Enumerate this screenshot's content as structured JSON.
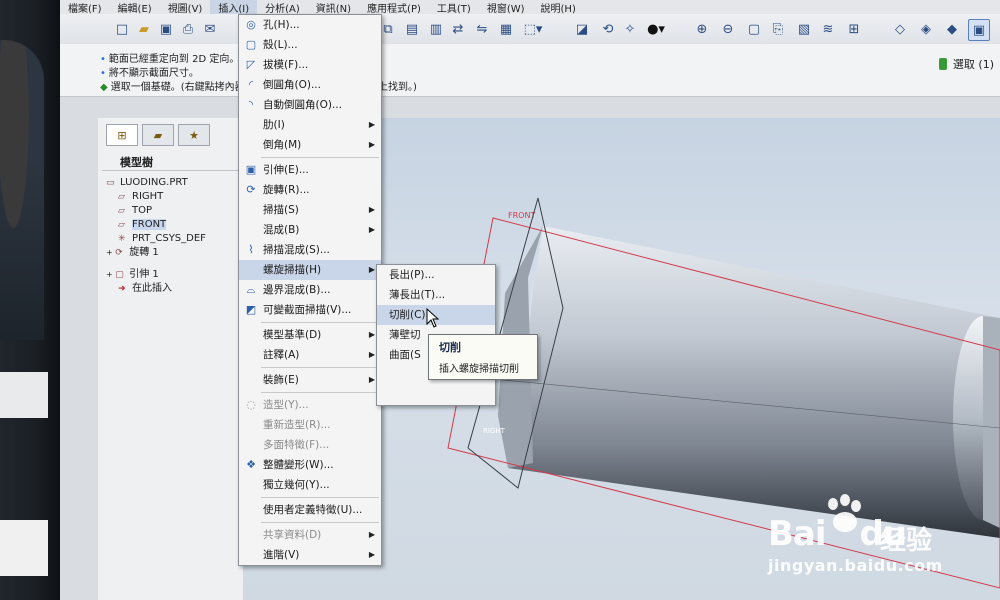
{
  "menubar": {
    "items": [
      "檔案(F)",
      "編輯(E)",
      "視圖(V)",
      "插入(I)",
      "分析(A)",
      "資訊(N)",
      "應用程式(P)",
      "工具(T)",
      "視窗(W)",
      "說明(H)"
    ]
  },
  "messages": [
    "範面已經重定向到 2D 定向。",
    "將不顯示截面尺寸。",
    "選取一個基礎。(右鍵點拷內器",
    "上找到。)"
  ],
  "select_label": "選取 (1)",
  "model_tree": {
    "title": "模型樹",
    "nodes": [
      {
        "label": "LUODING.PRT",
        "icon": "part-icon"
      },
      {
        "label": "RIGHT",
        "icon": "datum-plane-icon"
      },
      {
        "label": "TOP",
        "icon": "datum-plane-icon"
      },
      {
        "label": "FRONT",
        "icon": "datum-plane-icon",
        "selected": true
      },
      {
        "label": "PRT_CSYS_DEF",
        "icon": "csys-icon"
      },
      {
        "label": "旋轉 1",
        "icon": "revolve-icon"
      },
      {
        "label": "引伸 1",
        "icon": "extrude-icon"
      },
      {
        "label": "在此插入",
        "icon": "insert-here-icon"
      }
    ]
  },
  "insert_menu": {
    "items": [
      {
        "label": "孔(H)...",
        "icon": "hole-icon"
      },
      {
        "label": "殼(L)...",
        "icon": "shell-icon"
      },
      {
        "label": "拔模(F)...",
        "icon": "draft-icon"
      },
      {
        "label": "倒圓角(O)...",
        "icon": "round-icon"
      },
      {
        "label": "自動倒圓角(O)...",
        "icon": "auto-round-icon"
      },
      {
        "label": "肋(I)",
        "submenu": true
      },
      {
        "label": "倒角(M)",
        "submenu": true
      },
      {
        "label": "引伸(E)...",
        "icon": "extrude-icon"
      },
      {
        "label": "旋轉(R)...",
        "icon": "revolve-icon"
      },
      {
        "label": "掃描(S)",
        "submenu": true
      },
      {
        "label": "混成(B)",
        "submenu": true
      },
      {
        "label": "掃描混成(S)...",
        "icon": "swept-blend-icon"
      },
      {
        "label": "螺旋掃描(H)",
        "submenu": true,
        "highlighted": true
      },
      {
        "label": "邊界混成(B)...",
        "icon": "boundary-blend-icon"
      },
      {
        "label": "可變截面掃描(V)...",
        "icon": "variable-sweep-icon"
      },
      {
        "label": "模型基準(D)",
        "submenu": true
      },
      {
        "label": "註釋(A)",
        "submenu": true
      },
      {
        "label": "裝飾(E)",
        "submenu": true
      },
      {
        "label": "造型(Y)...",
        "icon": "style-icon",
        "disabled": true
      },
      {
        "label": "重新造型(R)...",
        "disabled": true
      },
      {
        "label": "多面特徵(F)...",
        "disabled": true
      },
      {
        "label": "整體變形(W)...",
        "icon": "warp-icon"
      },
      {
        "label": "獨立幾何(Y)..."
      },
      {
        "label": "使用者定義特徵(U)..."
      },
      {
        "label": "共享資料(D)",
        "submenu": true,
        "disabled": true
      },
      {
        "label": "進階(V)",
        "submenu": true
      }
    ]
  },
  "helical_submenu": {
    "items": [
      {
        "label": "長出(P)..."
      },
      {
        "label": "薄長出(T)..."
      },
      {
        "label": "切削(C)",
        "highlighted": true
      },
      {
        "label": "薄壁切"
      },
      {
        "label": "曲面(S"
      }
    ]
  },
  "tooltip": {
    "title": "切削",
    "desc": "插入螺旋掃描切削"
  },
  "viewport": {
    "plane_label": "FRONT",
    "coord_label": "RIGHT"
  },
  "watermark": {
    "brand": "Bai",
    "brand2": "du",
    "cn": "经验",
    "url": "jingyan.baidu.com"
  }
}
